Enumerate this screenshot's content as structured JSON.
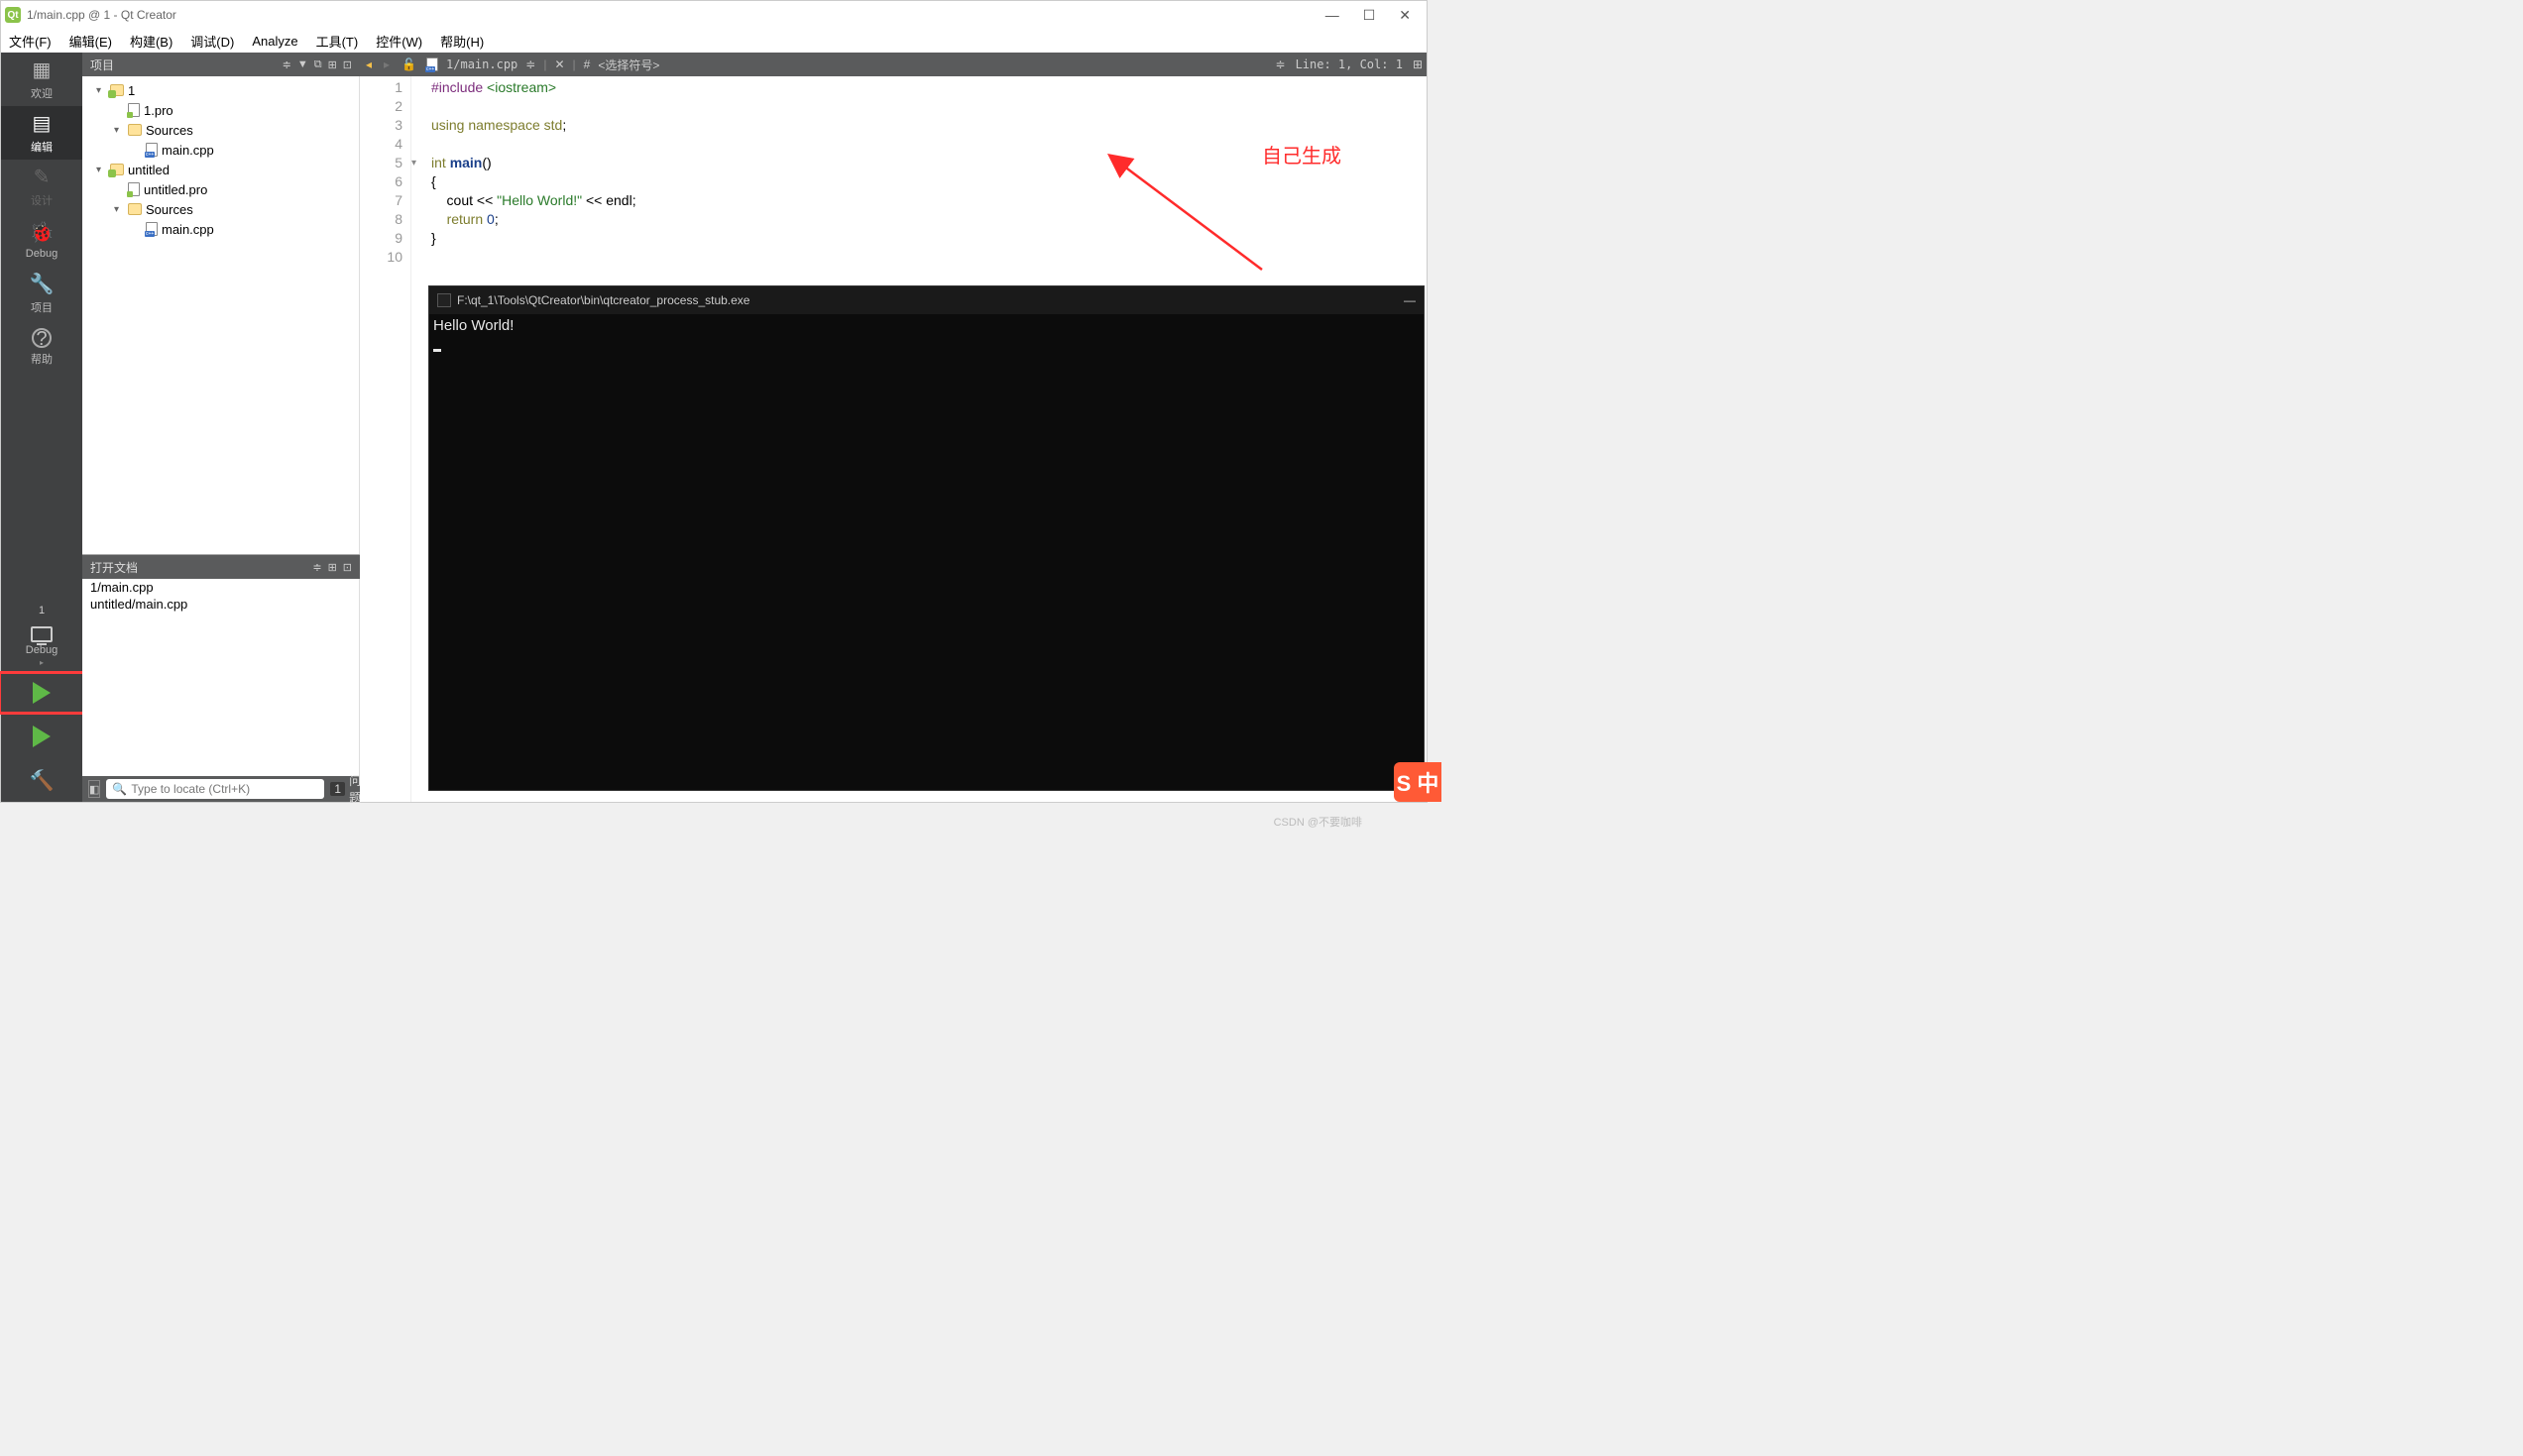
{
  "window": {
    "title": "1/main.cpp @ 1 - Qt Creator"
  },
  "winbtns": {
    "min": "—",
    "max": "☐",
    "close": "✕"
  },
  "menubar": [
    "文件(F)",
    "编辑(E)",
    "构建(B)",
    "调试(D)",
    "Analyze",
    "工具(T)",
    "控件(W)",
    "帮助(H)"
  ],
  "leftbar": {
    "modes": [
      {
        "label": "欢迎",
        "icon": "⫶⫶"
      },
      {
        "label": "编辑",
        "icon": "▤",
        "active": true
      },
      {
        "label": "设计",
        "icon": "✎",
        "disabled": true
      },
      {
        "label": "Debug",
        "icon": "🐞"
      },
      {
        "label": "项目",
        "icon": "🔧"
      },
      {
        "label": "帮助",
        "icon": "?"
      }
    ],
    "kit_project": "1",
    "kit_mode": "Debug"
  },
  "projects_panel": {
    "title": "项目",
    "tree": [
      {
        "depth": 0,
        "arrow": "▾",
        "icon": "proj-folder",
        "label": "1"
      },
      {
        "depth": 1,
        "arrow": "",
        "icon": "pro-file",
        "label": "1.pro"
      },
      {
        "depth": 1,
        "arrow": "▾",
        "icon": "folder",
        "label": "Sources"
      },
      {
        "depth": 2,
        "arrow": "",
        "icon": "cpp-file",
        "label": "main.cpp"
      },
      {
        "depth": 0,
        "arrow": "▾",
        "icon": "proj-folder",
        "label": "untitled"
      },
      {
        "depth": 1,
        "arrow": "",
        "icon": "pro-file",
        "label": "untitled.pro"
      },
      {
        "depth": 1,
        "arrow": "▾",
        "icon": "folder",
        "label": "Sources"
      },
      {
        "depth": 2,
        "arrow": "",
        "icon": "cpp-file",
        "label": "main.cpp"
      }
    ]
  },
  "opendocs_panel": {
    "title": "打开文档",
    "items": [
      "1/main.cpp",
      "untitled/main.cpp"
    ]
  },
  "editor": {
    "nav_back": "◂",
    "nav_fwd": "▸",
    "lock": "🔓",
    "filename": "1/main.cpp",
    "close": "✕",
    "symbol_hash": "#",
    "symbol_sel": "<选择符号>",
    "linecol": "Line: 1, Col: 1",
    "split": "⊞",
    "lines": [
      {
        "n": "1",
        "html": "<span class='kw-pp'>#include</span> <span class='kw-inc'>&lt;iostream&gt;</span>"
      },
      {
        "n": "2",
        "html": ""
      },
      {
        "n": "3",
        "html": "<span class='kw-olive'>using</span> <span class='kw-olive'>namespace</span> <span class='kw-type'>std</span>;"
      },
      {
        "n": "4",
        "html": ""
      },
      {
        "n": "5",
        "html": "<span class='kw-olive'>int</span> <span class='kw-fn'>main</span>()",
        "fold": "▾"
      },
      {
        "n": "6",
        "html": "{"
      },
      {
        "n": "7",
        "html": "    cout &lt;&lt; <span class='kw-str'>\"Hello World!\"</span> &lt;&lt; endl;"
      },
      {
        "n": "8",
        "html": "    <span class='kw-olive'>return</span> <span class='kw-num'>0</span>;"
      },
      {
        "n": "9",
        "html": "}"
      },
      {
        "n": "10",
        "html": ""
      }
    ]
  },
  "annotation_text": "自己生成",
  "console": {
    "title": "F:\\qt_1\\Tools\\QtCreator\\bin\\qtcreator_process_stub.exe",
    "min": "—",
    "output": "Hello World!"
  },
  "bottombar": {
    "locate_placeholder": "Type to locate (Ctrl+K)",
    "issues_num": "1",
    "issues_label": "问题"
  },
  "watermark": "CSDN @不要咖啡",
  "sogou": "S 中"
}
